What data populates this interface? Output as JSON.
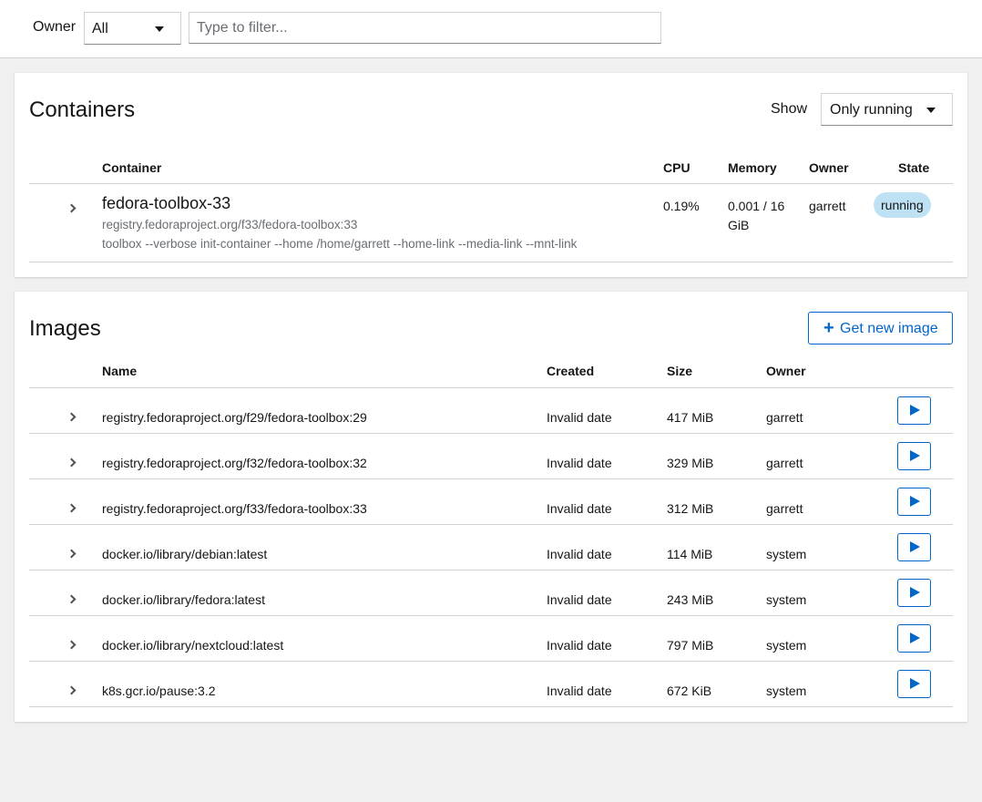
{
  "toolbar": {
    "owner_label": "Owner",
    "owner_value": "All",
    "filter_placeholder": "Type to filter..."
  },
  "containers": {
    "title": "Containers",
    "show_label": "Show",
    "show_value": "Only running",
    "columns": {
      "container": "Container",
      "cpu": "CPU",
      "memory": "Memory",
      "owner": "Owner",
      "state": "State"
    },
    "rows": [
      {
        "name": "fedora-toolbox-33",
        "image": "registry.fedoraproject.org/f33/fedora-toolbox:33",
        "command": "toolbox --verbose init-container --home /home/garrett --home-link --media-link --mnt-link",
        "cpu": "0.19%",
        "memory": "0.001 / 16 GiB",
        "owner": "garrett",
        "state": "running"
      }
    ]
  },
  "images": {
    "title": "Images",
    "get_new_label": "Get new image",
    "columns": {
      "name": "Name",
      "created": "Created",
      "size": "Size",
      "owner": "Owner"
    },
    "rows": [
      {
        "name": "registry.fedoraproject.org/f29/fedora-toolbox:29",
        "created": "Invalid date",
        "size": "417 MiB",
        "owner": "garrett"
      },
      {
        "name": "registry.fedoraproject.org/f32/fedora-toolbox:32",
        "created": "Invalid date",
        "size": "329 MiB",
        "owner": "garrett"
      },
      {
        "name": "registry.fedoraproject.org/f33/fedora-toolbox:33",
        "created": "Invalid date",
        "size": "312 MiB",
        "owner": "garrett"
      },
      {
        "name": "docker.io/library/debian:latest",
        "created": "Invalid date",
        "size": "114 MiB",
        "owner": "system"
      },
      {
        "name": "docker.io/library/fedora:latest",
        "created": "Invalid date",
        "size": "243 MiB",
        "owner": "system"
      },
      {
        "name": "docker.io/library/nextcloud:latest",
        "created": "Invalid date",
        "size": "797 MiB",
        "owner": "system"
      },
      {
        "name": "k8s.gcr.io/pause:3.2",
        "created": "Invalid date",
        "size": "672 KiB",
        "owner": "system"
      }
    ]
  },
  "colors": {
    "accent": "#0066cc",
    "running_badge": "#bee1f4",
    "page_bg": "#f0f0f0"
  }
}
